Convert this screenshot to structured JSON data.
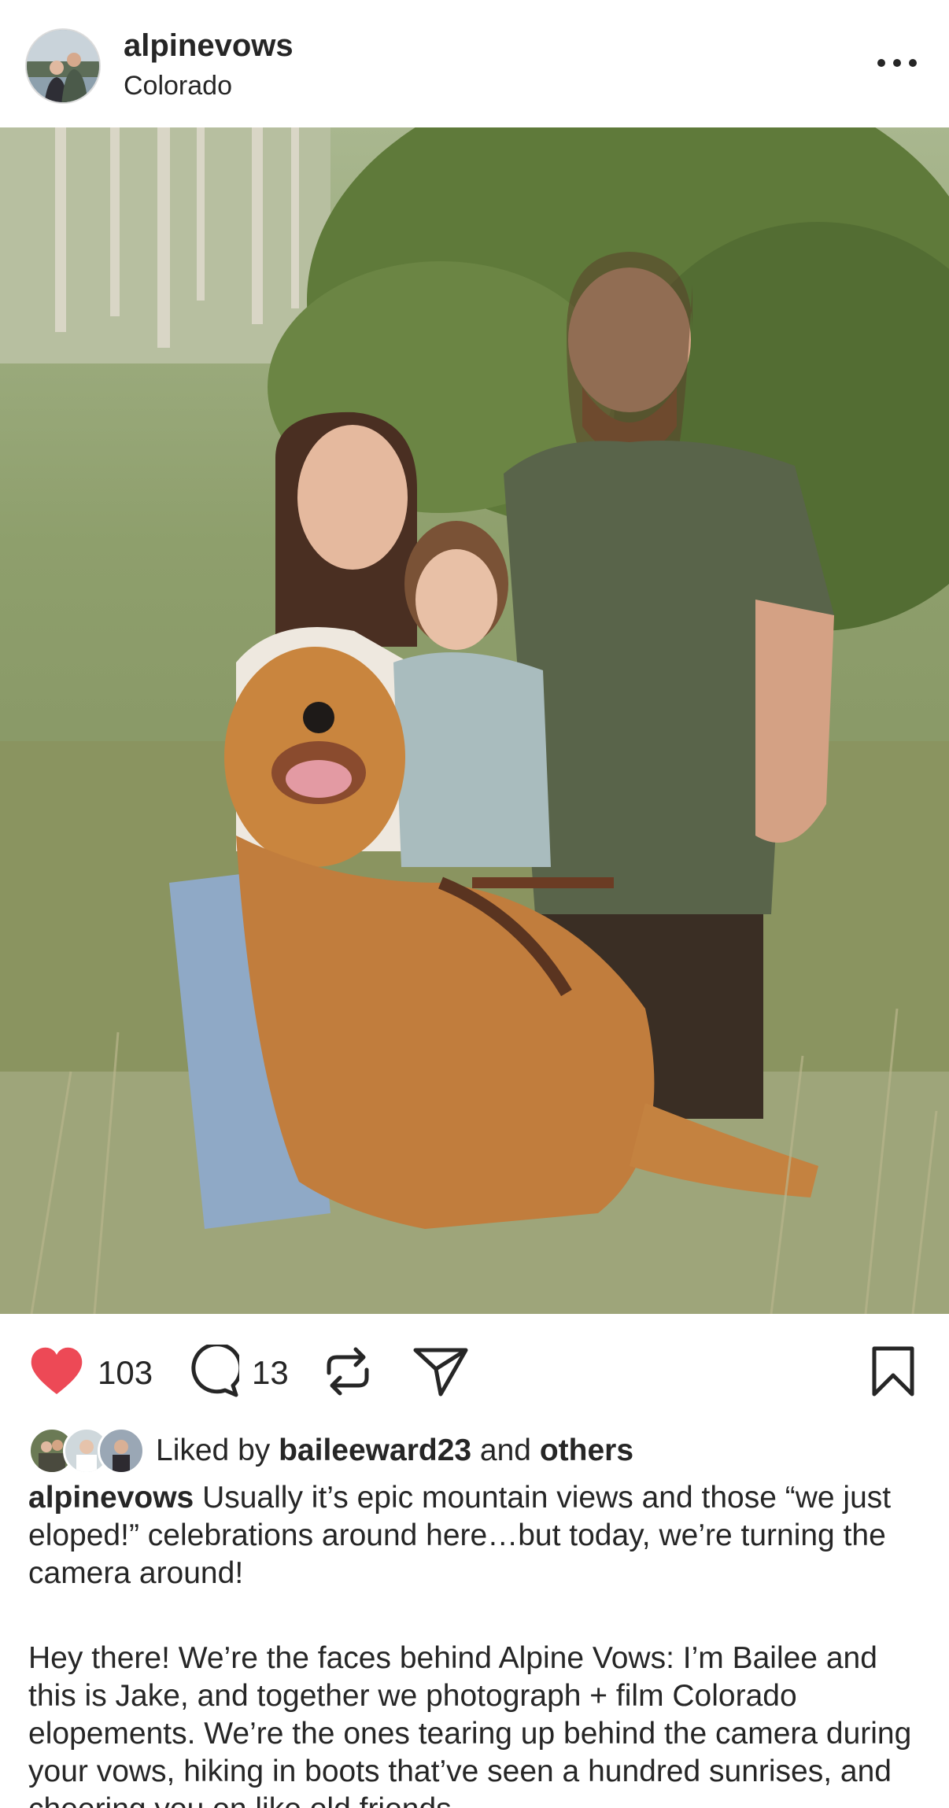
{
  "header": {
    "username": "alpinevows",
    "location": "Colorado",
    "more_icon": "more-horizontal-icon"
  },
  "post": {
    "image_description_icon": "photo",
    "likes_count": "103",
    "comments_count": "13",
    "liked": true,
    "accent_color": "#ed4956",
    "icons": [
      "heart-icon",
      "comment-icon",
      "repost-icon",
      "share-icon",
      "bookmark-icon"
    ]
  },
  "liked_by": {
    "prefix": "Liked by",
    "user": "baileeward23",
    "conjunction": "and",
    "others": "others"
  },
  "caption": {
    "author": "alpinevows",
    "paragraph1": "Usually it’s epic mountain views and those “we just eloped!” celebrations around here…but today, we’re turning the camera around!",
    "paragraph2": "Hey there! We’re the faces behind Alpine Vows: I’m Bailee and this is Jake, and together we photograph + film Colorado elopements. We’re the ones tearing up behind the camera during your vows, hiking in boots that’ve seen a hundred sunrises, and cheering you on like old friends"
  }
}
